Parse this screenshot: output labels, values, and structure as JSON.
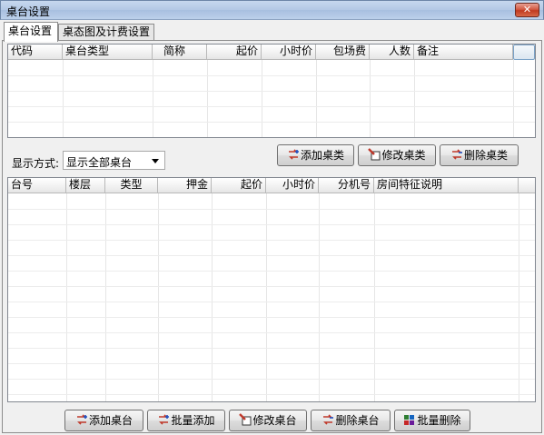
{
  "window": {
    "title": "桌台设置",
    "close_glyph": "✕"
  },
  "tabs": [
    {
      "label": "桌台设置",
      "active": true
    },
    {
      "label": "桌态图及计费设置",
      "active": false
    }
  ],
  "type_grid": {
    "columns": [
      "代码",
      "桌台类型",
      "简称",
      "起价",
      "小时价",
      "包场费",
      "人数",
      "备注"
    ],
    "rows": []
  },
  "display_mode": {
    "label": "显示方式:",
    "selected": "显示全部桌台"
  },
  "type_buttons": {
    "add": "添加桌类",
    "edit": "修改桌类",
    "delete": "删除桌类"
  },
  "table_grid": {
    "columns": [
      "台号",
      "楼层",
      "类型",
      "押金",
      "起价",
      "小时价",
      "分机号",
      "房间特征说明"
    ],
    "rows": []
  },
  "table_buttons": {
    "add": "添加桌台",
    "batch_add": "批量添加",
    "edit": "修改桌台",
    "delete": "删除桌台",
    "batch_delete": "批量删除"
  },
  "icons": {
    "add": "add-icon",
    "batch_add": "batch-add-icon",
    "edit": "edit-icon",
    "delete": "delete-icon",
    "batch_delete": "batch-delete-icon"
  }
}
